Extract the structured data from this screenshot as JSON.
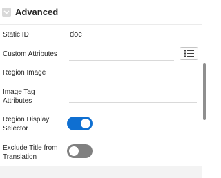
{
  "section": {
    "title": "Advanced",
    "expand_icon": "chevron-down-icon"
  },
  "fields": {
    "static_id": {
      "label": "Static ID",
      "value": "doc"
    },
    "custom_attributes": {
      "label": "Custom Attributes",
      "value": "",
      "button_icon": "list-icon"
    },
    "region_image": {
      "label": "Region Image",
      "value": ""
    },
    "image_tag_attributes": {
      "label_line1": "Image Tag",
      "label_line2": "Attributes",
      "value": ""
    },
    "region_display_selector": {
      "label_line1": "Region Display",
      "label_line2": "Selector",
      "state": "on"
    },
    "exclude_title": {
      "label_line1": "Exclude Title from",
      "label_line2": "Translation",
      "state": "off"
    }
  },
  "colors": {
    "toggle_on": "#0f6fd1",
    "toggle_off": "#808080"
  }
}
